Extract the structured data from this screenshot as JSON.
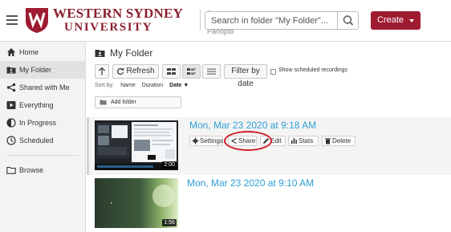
{
  "header": {
    "university_line1": "WESTERN SYDNEY",
    "university_line2": "UNIVERSITY",
    "powered_by": "Powered by Panopto",
    "search_placeholder": "Search in folder \"My Folder\"...",
    "create_label": "Create",
    "brand_color": "#9e1b32"
  },
  "sidebar": {
    "items": [
      {
        "label": "Home",
        "icon": "home-icon",
        "active": false
      },
      {
        "label": "My Folder",
        "icon": "folder-user-icon",
        "active": true
      },
      {
        "label": "Shared with Me",
        "icon": "share-icon",
        "active": false
      },
      {
        "label": "Everything",
        "icon": "video-play-icon",
        "active": false
      },
      {
        "label": "In Progress",
        "icon": "progress-icon",
        "active": false
      },
      {
        "label": "Scheduled",
        "icon": "clock-icon",
        "active": false
      }
    ],
    "browse_label": "Browse"
  },
  "main": {
    "folder_title": "My Folder",
    "toolbar": {
      "refresh_label": "Refresh",
      "filter_label": "Filter by date",
      "show_scheduled_label": "Show scheduled recordings",
      "show_scheduled_checked": false
    },
    "sort": {
      "label": "Sort by:",
      "options": [
        "Name",
        "Duration",
        "Date"
      ],
      "active": "Date"
    },
    "add_folder_label": "Add folder",
    "recordings": [
      {
        "title": "Mon, Mar 23 2020 at 9:18 AM",
        "duration": "2:00",
        "actions": [
          "Settings",
          "Share",
          "Edit",
          "Stats",
          "Delete"
        ],
        "highlighted_action": "Share"
      },
      {
        "title": "Mon, Mar 23 2020 at 9:10 AM",
        "duration": "1:56"
      }
    ],
    "link_color": "#2d9fd4",
    "highlight_color": "#d11f2a"
  }
}
